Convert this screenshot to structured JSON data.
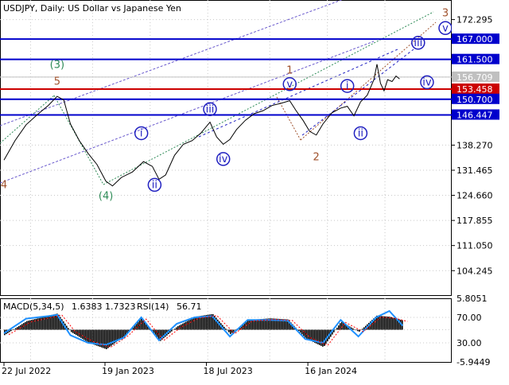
{
  "chart_data": [
    {
      "type": "line",
      "title": "USDJPY, Daily:  US Dollar vs Japanese Yen",
      "x": [
        "22 Jul 2022",
        "19 Jan 2023",
        "18 Jul 2023",
        "16 Jan 2024"
      ],
      "y_ticks": [
        "172.295",
        "167.000",
        "161.500",
        "156.709",
        "153.458",
        "150.700",
        "146.447",
        "138.270",
        "131.465",
        "124.660",
        "117.855",
        "111.050",
        "104.245"
      ],
      "ylim": [
        97.4,
        177.6
      ],
      "grid": true,
      "price_levels": [
        {
          "label": "167.000",
          "value": 167.0,
          "color": "#0000cc"
        },
        {
          "label": "161.500",
          "value": 161.5,
          "color": "#0000cc"
        },
        {
          "label": "153.458",
          "value": 153.458,
          "color": "#cc0000"
        },
        {
          "label": "150.700",
          "value": 150.7,
          "color": "#0000cc"
        },
        {
          "label": "146.447",
          "value": 146.447,
          "color": "#0000cc"
        }
      ],
      "current_price": {
        "label": "156.709",
        "value": 156.709
      },
      "series": [
        {
          "values": [
            [
              0.0,
              134.2
            ],
            [
              0.025,
              139.5
            ],
            [
              0.05,
              143.8
            ],
            [
              0.075,
              146.5
            ],
            [
              0.1,
              149.0
            ],
            [
              0.12,
              151.5
            ],
            [
              0.135,
              150.5
            ],
            [
              0.15,
              144.0
            ],
            [
              0.17,
              139.5
            ],
            [
              0.19,
              136.0
            ],
            [
              0.21,
              133.0
            ],
            [
              0.23,
              128.5
            ],
            [
              0.245,
              127.2
            ],
            [
              0.265,
              129.5
            ],
            [
              0.29,
              131.0
            ],
            [
              0.315,
              133.8
            ],
            [
              0.335,
              132.5
            ],
            [
              0.35,
              129.0
            ],
            [
              0.365,
              130.2
            ],
            [
              0.385,
              135.5
            ],
            [
              0.405,
              138.5
            ],
            [
              0.425,
              139.5
            ],
            [
              0.445,
              141.6
            ],
            [
              0.465,
              144.5
            ],
            [
              0.48,
              140.5
            ],
            [
              0.495,
              138.5
            ],
            [
              0.51,
              139.8
            ],
            [
              0.525,
              142.5
            ],
            [
              0.545,
              145.0
            ],
            [
              0.565,
              146.8
            ],
            [
              0.585,
              147.6
            ],
            [
              0.605,
              149.0
            ],
            [
              0.625,
              149.6
            ],
            [
              0.645,
              150.3
            ],
            [
              0.66,
              147.5
            ],
            [
              0.675,
              145.0
            ],
            [
              0.69,
              142.0
            ],
            [
              0.705,
              141.0
            ],
            [
              0.72,
              144.0
            ],
            [
              0.74,
              147.0
            ],
            [
              0.76,
              148.3
            ],
            [
              0.775,
              148.8
            ],
            [
              0.79,
              146.2
            ],
            [
              0.805,
              150.0
            ],
            [
              0.82,
              151.8
            ],
            [
              0.835,
              156.0
            ],
            [
              0.842,
              160.2
            ],
            [
              0.85,
              155.0
            ],
            [
              0.858,
              153.0
            ],
            [
              0.866,
              156.0
            ],
            [
              0.876,
              155.5
            ],
            [
              0.885,
              157.0
            ],
            [
              0.893,
              156.2
            ]
          ]
        }
      ],
      "wave_labels": [
        {
          "text": "(3)",
          "x": 0.12,
          "y": 160.0,
          "color": "#2e8b57",
          "circled": false
        },
        {
          "text": "5",
          "x": 0.12,
          "y": 155.5,
          "color": "#a0522d",
          "circled": false
        },
        {
          "text": "4",
          "x": 0.0,
          "y": 127.5,
          "color": "#a0522d",
          "circled": false
        },
        {
          "text": "(4)",
          "x": 0.23,
          "y": 124.5,
          "color": "#2e8b57",
          "circled": false
        },
        {
          "text": "i",
          "x": 0.31,
          "y": 141.5,
          "color": "#2020c0",
          "circled": true
        },
        {
          "text": "ii",
          "x": 0.34,
          "y": 127.5,
          "color": "#2020c0",
          "circled": true
        },
        {
          "text": "iii",
          "x": 0.465,
          "y": 148.0,
          "color": "#2020c0",
          "circled": true
        },
        {
          "text": "iv",
          "x": 0.495,
          "y": 134.5,
          "color": "#2020c0",
          "circled": true
        },
        {
          "text": "1",
          "x": 0.645,
          "y": 158.5,
          "color": "#a0522d",
          "circled": false
        },
        {
          "text": "v",
          "x": 0.645,
          "y": 154.8,
          "color": "#2020c0",
          "circled": true
        },
        {
          "text": "2",
          "x": 0.705,
          "y": 135.0,
          "color": "#a0522d",
          "circled": false
        },
        {
          "text": "i",
          "x": 0.775,
          "y": 154.3,
          "color": "#2020c0",
          "circled": true
        },
        {
          "text": "ii",
          "x": 0.805,
          "y": 141.5,
          "color": "#2020c0",
          "circled": true
        },
        {
          "text": "iii",
          "x": 0.935,
          "y": 166.0,
          "color": "#2020c0",
          "circled": true
        },
        {
          "text": "iv",
          "x": 0.955,
          "y": 155.3,
          "color": "#2020c0",
          "circled": true
        },
        {
          "text": "v",
          "x": 1.02,
          "y": 170.0,
          "color": "#2020c0",
          "circled": true
        },
        {
          "text": "3",
          "x": 1.025,
          "y": 174.0,
          "color": "#a0522d",
          "circled": false
        }
      ]
    },
    {
      "type": "bar",
      "title": "MACD(5,34,5)",
      "title_values": "1.6383 1.7323",
      "secondary_title": "RSI(14)",
      "secondary_value": "56.71",
      "y_ticks_left": [
        "5.8051",
        "-5.9449"
      ],
      "y_ticks_right": [
        "70.00",
        "30.00"
      ],
      "ylim": [
        -5.9449,
        5.8051
      ],
      "series": [
        {
          "name": "MACD",
          "values": [
            [
              0.0,
              -1.0
            ],
            [
              0.05,
              1.6
            ],
            [
              0.1,
              2.6
            ],
            [
              0.12,
              3.0
            ],
            [
              0.15,
              -0.4
            ],
            [
              0.19,
              -2.4
            ],
            [
              0.23,
              -3.6
            ],
            [
              0.27,
              -1.2
            ],
            [
              0.31,
              2.2
            ],
            [
              0.35,
              -2.2
            ],
            [
              0.39,
              0.6
            ],
            [
              0.43,
              2.4
            ],
            [
              0.47,
              2.9
            ],
            [
              0.51,
              -0.8
            ],
            [
              0.55,
              1.8
            ],
            [
              0.6,
              2.1
            ],
            [
              0.64,
              1.9
            ],
            [
              0.68,
              -1.6
            ],
            [
              0.72,
              -3.2
            ],
            [
              0.76,
              1.5
            ],
            [
              0.8,
              -0.4
            ],
            [
              0.84,
              2.6
            ],
            [
              0.87,
              2.4
            ],
            [
              0.9,
              1.7
            ]
          ]
        },
        {
          "name": "RSI",
          "values": [
            [
              0.0,
              45
            ],
            [
              0.05,
              68
            ],
            [
              0.1,
              72
            ],
            [
              0.12,
              74
            ],
            [
              0.15,
              42
            ],
            [
              0.19,
              30
            ],
            [
              0.23,
              27
            ],
            [
              0.27,
              38
            ],
            [
              0.31,
              70
            ],
            [
              0.35,
              34
            ],
            [
              0.39,
              60
            ],
            [
              0.43,
              70
            ],
            [
              0.47,
              72
            ],
            [
              0.51,
              40
            ],
            [
              0.55,
              66
            ],
            [
              0.6,
              66
            ],
            [
              0.64,
              65
            ],
            [
              0.68,
              36
            ],
            [
              0.72,
              30
            ],
            [
              0.76,
              66
            ],
            [
              0.8,
              40
            ],
            [
              0.84,
              70
            ],
            [
              0.87,
              80
            ],
            [
              0.9,
              57
            ]
          ]
        }
      ]
    }
  ]
}
